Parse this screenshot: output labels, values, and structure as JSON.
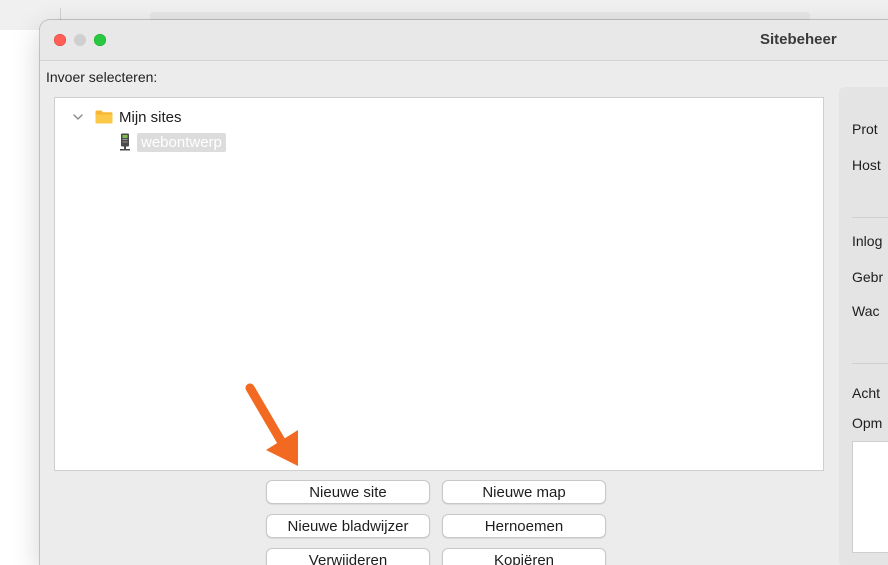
{
  "window": {
    "title": "Sitebeheer"
  },
  "select_label": "Invoer selecteren:",
  "tree": {
    "folder_label": "Mijn sites",
    "site_label": "webontwerp"
  },
  "buttons": {
    "new_site": "Nieuwe site",
    "new_folder": "Nieuwe map",
    "new_bookmark": "Nieuwe bladwijzer",
    "rename": "Hernoemen",
    "delete": "Verwijderen",
    "copy": "Kopiëren"
  },
  "right_panel": {
    "protocol": "Prot",
    "host": "Host",
    "login": "Inlog",
    "user": "Gebr",
    "password": "Wac",
    "background": "Acht",
    "comments": "Opm"
  },
  "colors": {
    "arrow": "#f26a22",
    "folder": "#f7b733",
    "traffic_close": "#ff5f57",
    "traffic_max": "#28c840"
  }
}
